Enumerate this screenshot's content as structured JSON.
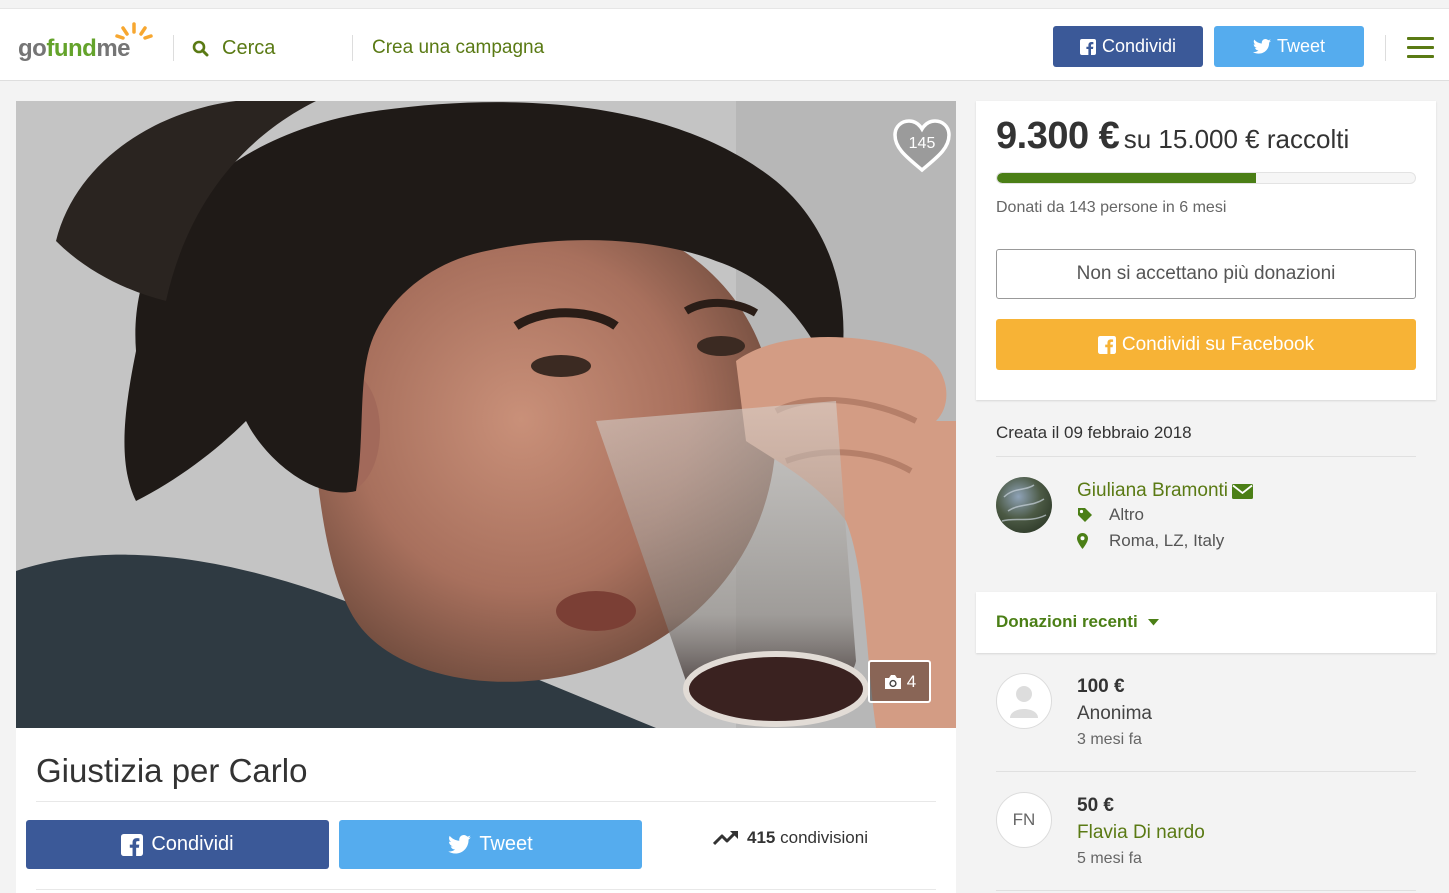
{
  "header": {
    "logo_text": {
      "go": "go",
      "fund": "fund",
      "me": "me"
    },
    "search_label": "Cerca",
    "create_label": "Crea una campagna",
    "share_facebook_label": "Condividi",
    "tweet_label": "Tweet"
  },
  "campaign": {
    "title": "Giustizia per Carlo",
    "likes_count": "145",
    "photo_count": "4",
    "share_facebook_label": "Condividi",
    "tweet_label": "Tweet",
    "shares_count": "415",
    "shares_label": "condivisioni"
  },
  "funding": {
    "raised": "9.300 €",
    "goal_text": "su 15.000 € raccolti",
    "progress_fraction": 0.62,
    "donors_text": "Donati da 143 persone in 6 mesi",
    "closed_button_label": "Non si accettano più donazioni",
    "facebook_share_label": "Condividi su Facebook"
  },
  "details": {
    "created_text": "Creata il 09 febbraio 2018",
    "organizer_name": "Giuliana Bramonti",
    "category": "Altro",
    "location": "Roma, LZ, Italy"
  },
  "recent_donations": {
    "header": "Donazioni recenti",
    "items": [
      {
        "amount": "100 €",
        "name": "Anonima",
        "time": "3 mesi fa",
        "initials": ""
      },
      {
        "amount": "50 €",
        "name": "Flavia Di nardo",
        "time": "5 mesi fa",
        "initials": "FN"
      }
    ]
  },
  "colors": {
    "brand_green": "#5a7a14",
    "progress_green": "#4b7f16",
    "facebook_blue": "#3b5998",
    "twitter_blue": "#55acee",
    "share_yellow": "#f7b336"
  },
  "icons": [
    "search-icon",
    "facebook-icon",
    "twitter-icon",
    "hamburger-menu-icon",
    "heart-icon",
    "camera-icon",
    "trending-icon",
    "envelope-icon",
    "tag-icon",
    "map-marker-icon",
    "caret-down-icon",
    "user-silhouette-icon"
  ]
}
